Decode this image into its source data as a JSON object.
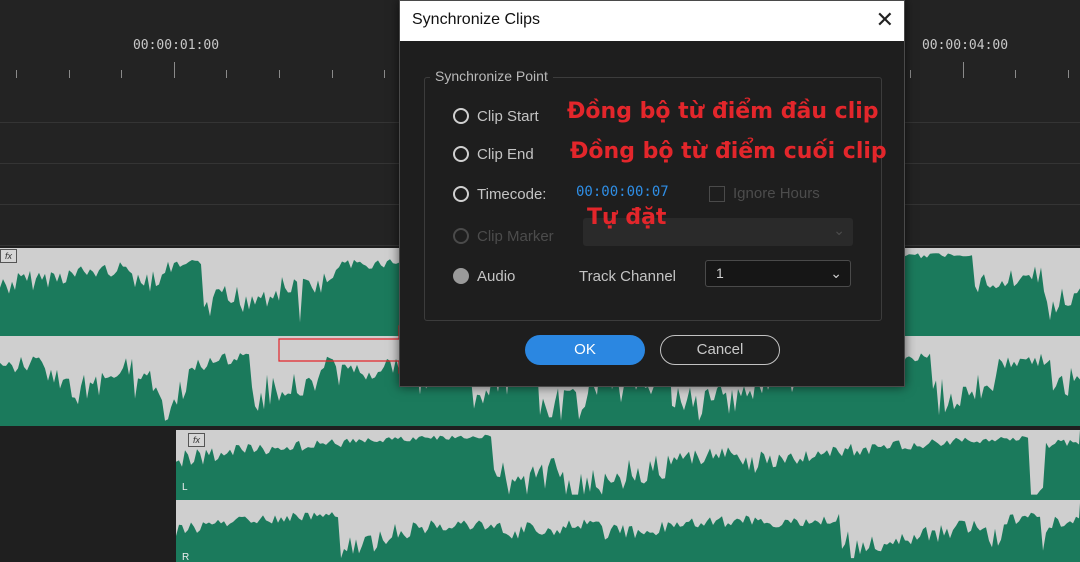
{
  "timeline": {
    "timecodes": [
      "00:00:01:00",
      "00:00:04:00"
    ],
    "audio_channel_labels": [
      "L",
      "R"
    ],
    "fx_label": "fx"
  },
  "dialog": {
    "title": "Synchronize Clips",
    "group_label": "Synchronize Point",
    "options": [
      {
        "label": "Clip Start",
        "enabled": true,
        "selected": false
      },
      {
        "label": "Clip End",
        "enabled": true,
        "selected": false
      },
      {
        "label": "Timecode:",
        "enabled": true,
        "selected": false
      },
      {
        "label": "Clip Marker",
        "enabled": false,
        "selected": false
      },
      {
        "label": "Audio",
        "enabled": true,
        "selected": true
      }
    ],
    "timecode_value": "00:00:00:07",
    "ignore_hours_label": "Ignore Hours",
    "track_channel_label": "Track Channel",
    "track_channel_value": "1",
    "ok_label": "OK",
    "cancel_label": "Cancel"
  },
  "annotations": {
    "clip_start": "Đồng bộ từ điểm đầu clip",
    "clip_end": "Đồng bộ từ điểm cuối clip",
    "timecode": "Tự đặt",
    "color": "#e3262b"
  },
  "colors": {
    "waveform_green": "#1b7a5c",
    "waveform_gray": "#cfcfcf",
    "accent_blue": "#2b87e1",
    "timecode_blue": "#2f8ee5"
  }
}
